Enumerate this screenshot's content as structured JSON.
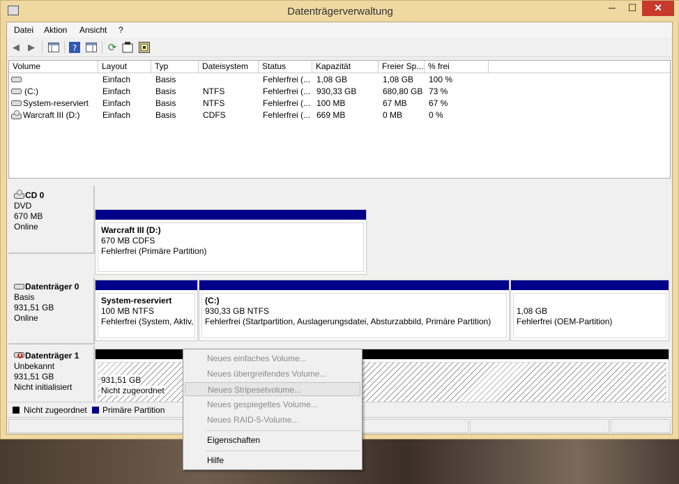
{
  "window": {
    "title": "Datenträgerverwaltung",
    "controls": {
      "minimize": "─",
      "maximize": "☐",
      "close": "✕"
    }
  },
  "menu": [
    "Datei",
    "Aktion",
    "Ansicht",
    "?"
  ],
  "toolbar": {
    "icons": [
      "back-arrow-icon",
      "forward-arrow-icon",
      "console-tree-icon",
      "help-icon",
      "properties-pane-icon",
      "refresh-icon",
      "properties-icon",
      "settings-icon"
    ]
  },
  "volume_table": {
    "columns": [
      "Volume",
      "Layout",
      "Typ",
      "Dateisystem",
      "Status",
      "Kapazität",
      "Freier Sp...",
      "% frei"
    ],
    "rows": [
      {
        "volume": "",
        "layout": "Einfach",
        "typ": "Basis",
        "fs": "",
        "status": "Fehlerfrei (...",
        "kap": "1,08 GB",
        "frei": "1,08 GB",
        "pct": "100 %"
      },
      {
        "volume": "(C:)",
        "layout": "Einfach",
        "typ": "Basis",
        "fs": "NTFS",
        "status": "Fehlerfrei (...",
        "kap": "930,33 GB",
        "frei": "680,80 GB",
        "pct": "73 %"
      },
      {
        "volume": "System-reserviert",
        "layout": "Einfach",
        "typ": "Basis",
        "fs": "NTFS",
        "status": "Fehlerfrei (...",
        "kap": "100 MB",
        "frei": "67 MB",
        "pct": "67 %"
      },
      {
        "volume": "Warcraft III (D:)",
        "layout": "Einfach",
        "typ": "Basis",
        "fs": "CDFS",
        "status": "Fehlerfrei (...",
        "kap": "669 MB",
        "frei": "0 MB",
        "pct": "0 %"
      }
    ]
  },
  "disks": [
    {
      "name": "CD 0",
      "l1": "DVD",
      "l2": "670 MB",
      "l3": "Online",
      "parts": [
        {
          "title": "Warcraft III  (D:)",
          "l1": "670 MB CDFS",
          "l2": "Fehlerfrei (Primäre Partition)"
        }
      ]
    },
    {
      "name": "Datenträger 0",
      "l1": "Basis",
      "l2": "931,51 GB",
      "l3": "Online",
      "parts": [
        {
          "title": "System-reserviert",
          "l1": "100 MB NTFS",
          "l2": "Fehlerfrei (System, Aktiv,"
        },
        {
          "title": "(C:)",
          "l1": "930,33 GB NTFS",
          "l2": "Fehlerfrei (Startpartition, Auslagerungsdatei, Absturzabbild, Primäre Partition)"
        },
        {
          "title": "",
          "l1": "1,08 GB",
          "l2": "Fehlerfrei (OEM-Partition)"
        }
      ]
    },
    {
      "name": "Datenträger 1",
      "l1": "Unbekannt",
      "l2": "931,51 GB",
      "l3": "Nicht initialisiert",
      "parts": [
        {
          "title": "",
          "l1": "931,51 GB",
          "l2": "Nicht zugeordnet"
        }
      ]
    }
  ],
  "legend": [
    {
      "label": "Nicht zugeordnet",
      "color": "#000000"
    },
    {
      "label": "Primäre Partition",
      "color": "#00008b"
    }
  ],
  "context_menu": {
    "items": [
      "Neues einfaches Volume...",
      "Neues übergreifendes Volume...",
      "Neues Stripesetvolume...",
      "Neues gespiegeltes Volume...",
      "Neues RAID-5-Volume...",
      "Eigenschaften",
      "Hilfe"
    ]
  },
  "colors": {
    "accent": "#f0d9a1",
    "partition_bar": "#00008b",
    "unallocated_bar": "#000000",
    "close": "#c7392b"
  }
}
